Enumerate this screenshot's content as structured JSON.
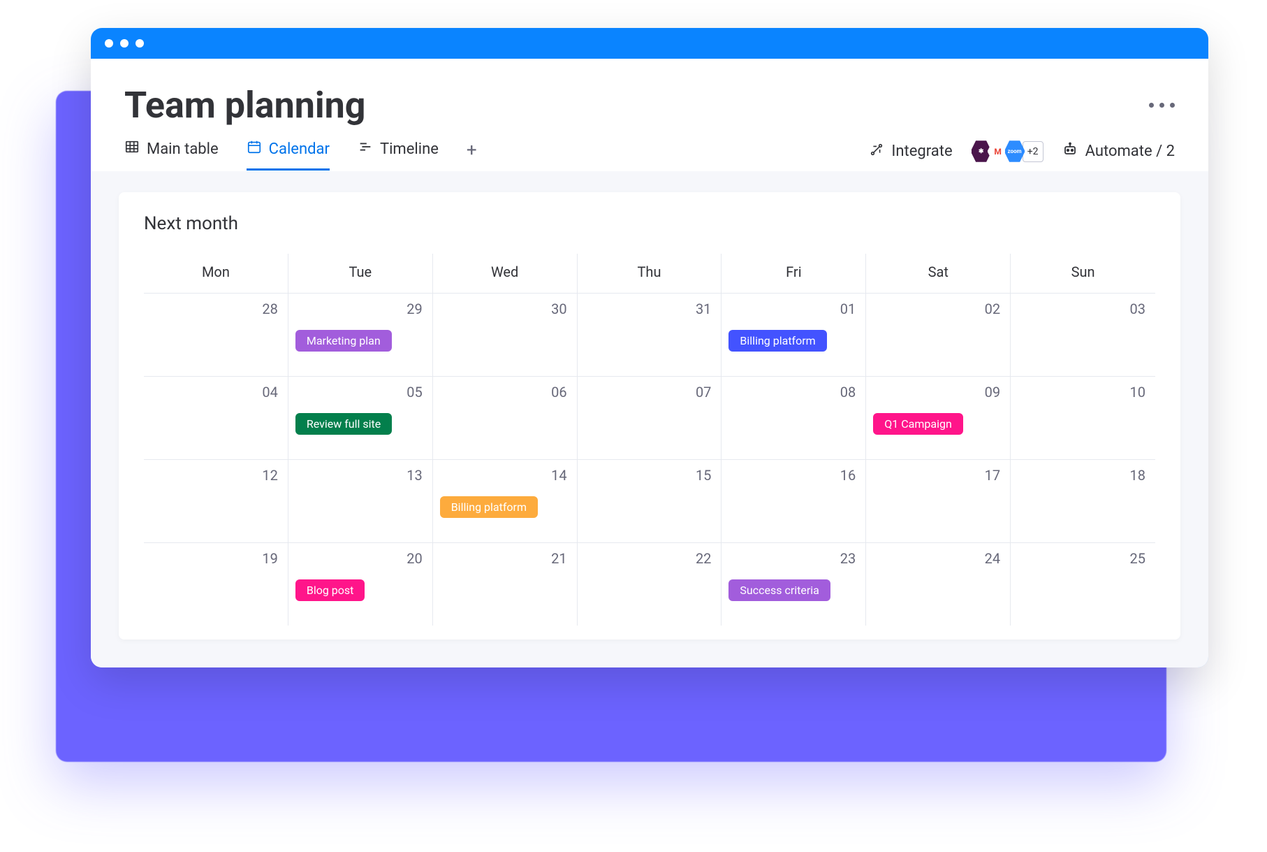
{
  "page_title": "Team planning",
  "tabs": [
    {
      "id": "main-table",
      "label": "Main table",
      "icon": "table"
    },
    {
      "id": "calendar",
      "label": "Calendar",
      "icon": "calendar",
      "active": true
    },
    {
      "id": "timeline",
      "label": "Timeline",
      "icon": "timeline"
    }
  ],
  "actions": {
    "integrate_label": "Integrate",
    "integrations_extra": "+2",
    "automate_label": "Automate / 2"
  },
  "calendar": {
    "title": "Next month",
    "weekday_labels": [
      "Mon",
      "Tue",
      "Wed",
      "Thu",
      "Fri",
      "Sat",
      "Sun"
    ],
    "weeks": [
      [
        {
          "num": "28"
        },
        {
          "num": "29",
          "event": {
            "label": "Marketing plan",
            "color": "#a25ddc"
          }
        },
        {
          "num": "30"
        },
        {
          "num": "31"
        },
        {
          "num": "01",
          "event": {
            "label": "Billing platform",
            "color": "#4353ff"
          }
        },
        {
          "num": "02"
        },
        {
          "num": "03"
        }
      ],
      [
        {
          "num": "04"
        },
        {
          "num": "05",
          "event": {
            "label": "Review full site",
            "color": "#037f4c"
          }
        },
        {
          "num": "06"
        },
        {
          "num": "07"
        },
        {
          "num": "08"
        },
        {
          "num": "09",
          "event": {
            "label": "Q1 Campaign",
            "color": "#ff158a"
          }
        },
        {
          "num": "10"
        }
      ],
      [
        {
          "num": "12"
        },
        {
          "num": "13"
        },
        {
          "num": "14",
          "event": {
            "label": "Billing platform",
            "color": "#fdab3d"
          }
        },
        {
          "num": "15"
        },
        {
          "num": "16"
        },
        {
          "num": "17"
        },
        {
          "num": "18"
        }
      ],
      [
        {
          "num": "19"
        },
        {
          "num": "20",
          "event": {
            "label": "Blog post",
            "color": "#ff158a"
          }
        },
        {
          "num": "21"
        },
        {
          "num": "22"
        },
        {
          "num": "23",
          "event": {
            "label": "Success criteria",
            "color": "#a25ddc"
          }
        },
        {
          "num": "24"
        },
        {
          "num": "25"
        }
      ]
    ]
  }
}
